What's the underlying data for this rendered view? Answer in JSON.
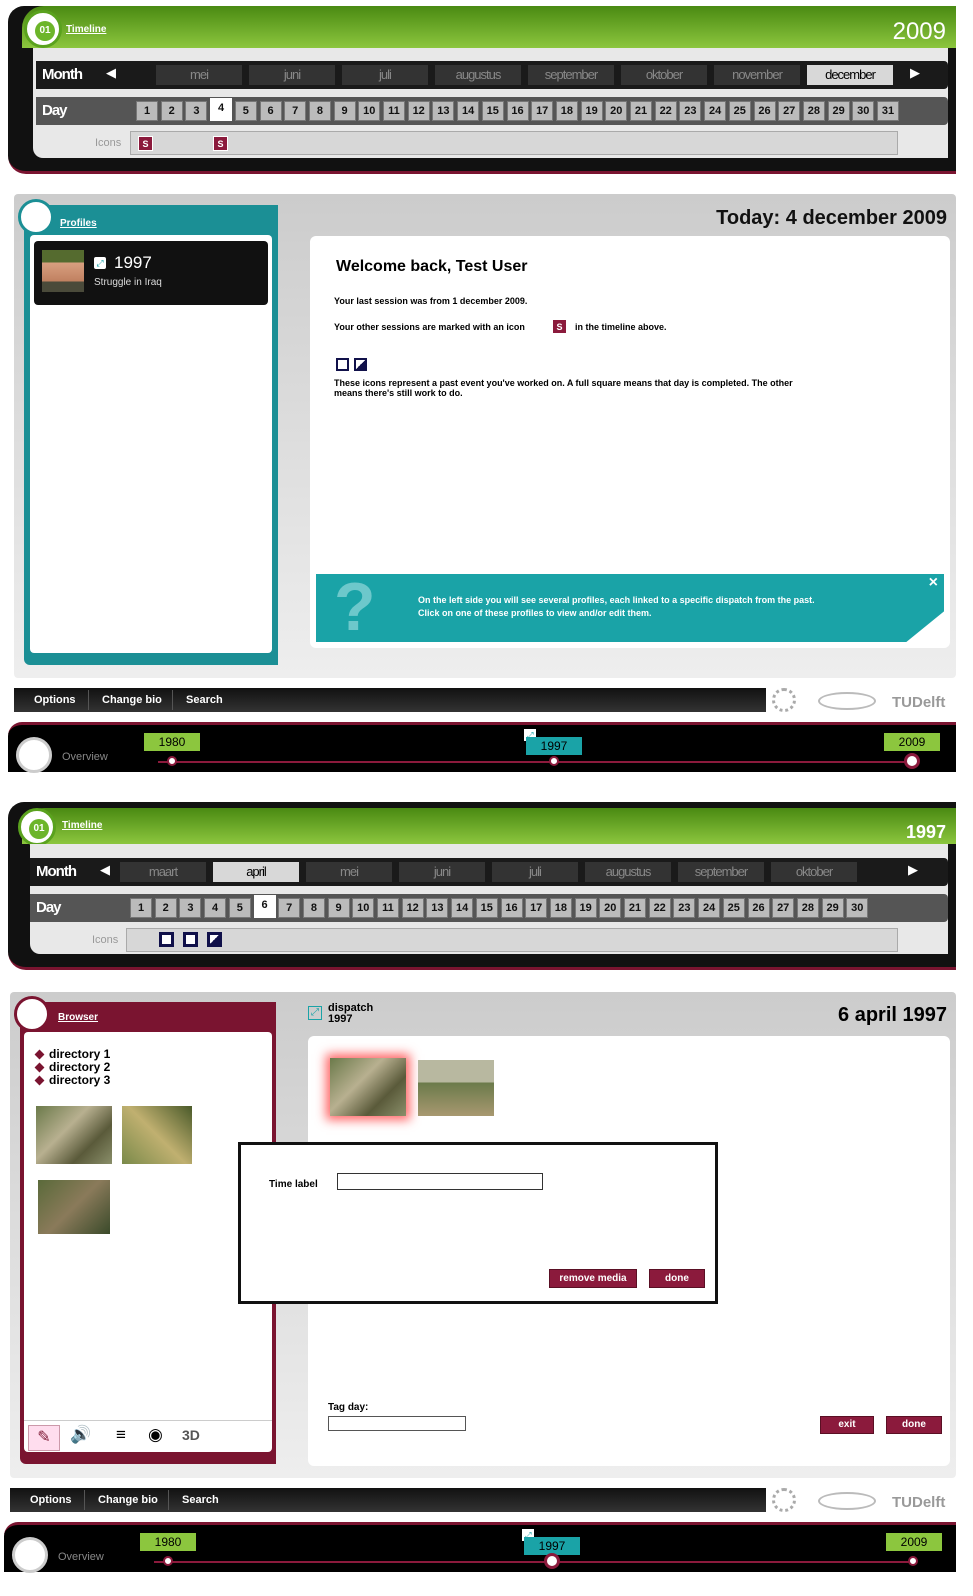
{
  "screen1": {
    "timeline": {
      "title": "Timeline",
      "year": "2009",
      "month_label": "Month",
      "day_label": "Day",
      "icons_label": "Icons",
      "months": [
        "mei",
        "juni",
        "juli",
        "augustus",
        "september",
        "oktober",
        "november",
        "december"
      ],
      "selected_month": "december",
      "days": [
        "1",
        "2",
        "3",
        "4",
        "5",
        "6",
        "7",
        "8",
        "9",
        "10",
        "11",
        "12",
        "13",
        "14",
        "15",
        "16",
        "17",
        "18",
        "19",
        "20",
        "21",
        "22",
        "23",
        "24",
        "25",
        "26",
        "27",
        "28",
        "29",
        "30",
        "31"
      ],
      "selected_day": "4",
      "session_badge": "S"
    },
    "profiles": {
      "title": "Profiles",
      "item_year": "1997",
      "item_desc": "Struggle in Iraq"
    },
    "today": "Today: 4 december 2009",
    "welcome": {
      "heading": "Welcome back, Test User",
      "line1": "Your last session was from 1 december 2009.",
      "line2a": "Your other sessions are marked with an icon",
      "badge": "S",
      "line2b": "in the timeline above.",
      "line3": "These icons represent a past event you've worked on. A full square means that day is completed. The other means there's still work to do."
    },
    "help": {
      "line1": "On the left side you will see several profiles, each linked to a specific dispatch from the past.",
      "line2": "Click on one of these profiles to view and/or edit them.",
      "close": "×"
    },
    "bottombar": {
      "options": "Options",
      "changebio": "Change bio",
      "search": "Search",
      "logo": "TUDelft"
    },
    "overview": {
      "label": "Overview",
      "y1": "1980",
      "y2": "1997",
      "y3": "2009"
    }
  },
  "screen2": {
    "timeline": {
      "title": "Timeline",
      "year": "1997",
      "month_label": "Month",
      "day_label": "Day",
      "icons_label": "Icons",
      "months": [
        "maart",
        "april",
        "mei",
        "juni",
        "juli",
        "augustus",
        "september",
        "oktober"
      ],
      "selected_month": "april",
      "days": [
        "1",
        "2",
        "3",
        "4",
        "5",
        "6",
        "7",
        "8",
        "9",
        "10",
        "11",
        "12",
        "13",
        "14",
        "15",
        "16",
        "17",
        "18",
        "19",
        "20",
        "21",
        "22",
        "23",
        "24",
        "25",
        "26",
        "27",
        "28",
        "29",
        "30"
      ],
      "selected_day": "6"
    },
    "browser": {
      "title": "Browser",
      "dirs": [
        "directory 1",
        "directory 2",
        "directory 3"
      ],
      "tool_3d": "3D"
    },
    "dispatch": {
      "label": "dispatch",
      "year": "1997",
      "date": "6 april 1997"
    },
    "dialog": {
      "time_label": "Time label",
      "remove": "remove media",
      "done": "done"
    },
    "tag_day": "Tag day:",
    "exit": "exit",
    "done": "done",
    "bottombar": {
      "options": "Options",
      "changebio": "Change bio",
      "search": "Search",
      "logo": "TUDelft"
    },
    "overview": {
      "label": "Overview",
      "y1": "1980",
      "y2": "1997",
      "y3": "2009"
    }
  }
}
